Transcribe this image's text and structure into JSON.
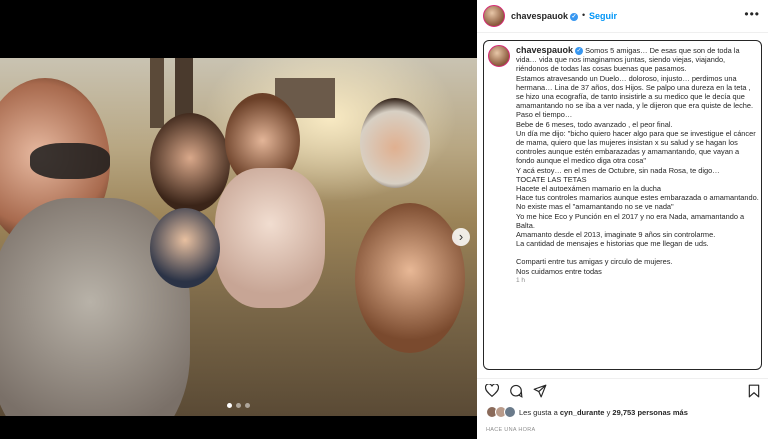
{
  "post": {
    "username": "chavespauok",
    "follow_label": "Seguir",
    "separator": "•",
    "more_icon": "more-horizontal-icon"
  },
  "caption": {
    "username": "chavespauok",
    "lines": [
      "Somos 5 amigas… De esas que son de toda la vida… vida que nos imaginamos juntas, siendo viejas, viajando, riéndonos de todas las cosas buenas que pasamos.",
      "Estamos atravesando un Duelo… doloroso, injusto… perdimos una hermana… Lina de 37 años, dos Hijos. Se palpo una dureza en la teta , se hizo una ecografía, de tanto insistirle a su medico que le decía que amamantando no se iba a ver nada, y le dijeron que era quiste de leche.",
      "Paso el tiempo…",
      "Bebe de 6 meses, todo avanzado , el peor final.",
      "Un día me dijo: \"bicho quiero hacer algo para que se investigue el cáncer de mama, quiero que las mujeres insistan x su salud y se hagan los controles aunque estén embarazadas y amamantando, que vayan a fondo aunque el medico diga otra cosa\"",
      "Y acá estoy… en el mes de Octubre, sin nada Rosa, te digo…",
      "TOCATE LAS TETAS",
      "Hacete el autoexámen mamario en la ducha",
      "Hace tus controles mamarios aunque estes embarazada o amamantando.",
      "No existe mas el \"amamantando no se ve nada\"",
      "Yo me hice Eco y Punción en el 2017 y no era Nada, amamantando a Balta.",
      "Amamanto desde el 2013, imaginate 9 años sin controlarme.",
      "La cantidad de mensajes e historias que me llegan de uds.",
      "",
      "Comparti entre tus amigas y circulo de mujeres.",
      "Nos cuidamos entre todas"
    ],
    "time": "1 h"
  },
  "actions": {
    "like_icon": "heart-icon",
    "comment_icon": "comment-icon",
    "share_icon": "share-icon",
    "save_icon": "bookmark-icon"
  },
  "likes": {
    "prefix": "Les gusta a ",
    "user": "cyn_durante",
    "middle": " y ",
    "count": "29,753",
    "suffix": " personas más"
  },
  "timestamp": "HACE UNA HORA",
  "carousel": {
    "slides": 3,
    "active": 0
  }
}
